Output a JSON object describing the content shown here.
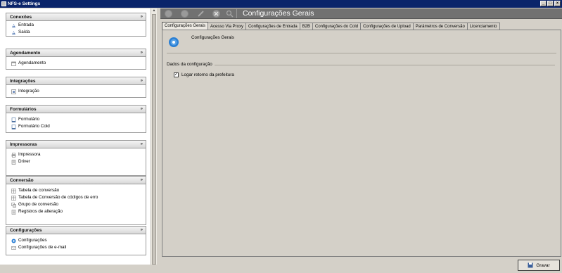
{
  "window": {
    "title": "NFS-e Settings",
    "min": "_",
    "max": "□",
    "close": "×"
  },
  "sidebar": {
    "sections": [
      {
        "title": "Conexões",
        "items": [
          "Entrada",
          "Saída"
        ]
      },
      {
        "title": "Agendamento",
        "items": [
          "Agendamento"
        ]
      },
      {
        "title": "Integrações",
        "items": [
          "Integração"
        ]
      },
      {
        "title": "Formulários",
        "items": [
          "Formulário",
          "Formulário Cold"
        ]
      },
      {
        "title": "Impressoras",
        "items": [
          "Impressora",
          "Driver"
        ]
      },
      {
        "title": "Conversão",
        "items": [
          "Tabela de conversão",
          "Tabela de Conversão de códigos de erro",
          "Grupo de conversão",
          "Registros de alteração"
        ]
      },
      {
        "title": "Configurações",
        "items": [
          "Configurações",
          "Configurações de e-mail"
        ]
      }
    ],
    "chevron": "»"
  },
  "main": {
    "title": "Configurações Gerais",
    "tabs": [
      "Configurações Gerais",
      "Acesso Via Proxy",
      "Configurações de Entrada",
      "B2B",
      "Configurações do Cold",
      "Configurações de Upload",
      "Parâmetros de Conversão",
      "Licenciamento"
    ],
    "panel_title": "Configurações Gerais",
    "group_label": "Dados da configuração",
    "checkbox_label": "Logar retorno da prefeitura",
    "checkbox_checked": true,
    "save_label": "Gravar"
  },
  "colors": {
    "titlebar": "#0a246a",
    "toolbar": "#717171",
    "accent": "#2a7fd4"
  }
}
